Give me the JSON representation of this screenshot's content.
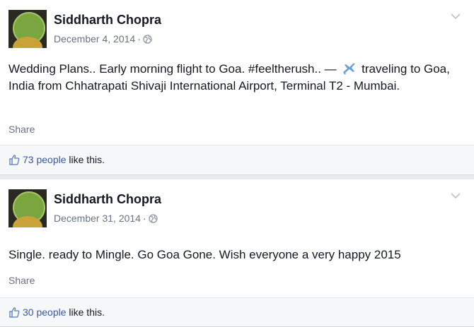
{
  "posts": [
    {
      "author": "Siddharth Chopra",
      "date": "December 4, 2014",
      "separator": "·",
      "text_before_icon": "Wedding Plans.. Early morning flight to Goa. #feeltherush.. —",
      "text_after_icon": "traveling to Goa, India from Chhatrapati Shivaji International Airport, Terminal T2 - Mumbai.",
      "share_label": "Share",
      "likes_count": "73 people",
      "likes_suffix": " like this."
    },
    {
      "author": "Siddharth Chopra",
      "date": "December 31, 2014",
      "separator": "·",
      "text": "Single. ready to Mingle. Go Goa Gone. Wish everyone a very happy 2015",
      "share_label": "Share",
      "likes_count": "30 people",
      "likes_suffix": " like this."
    }
  ],
  "colors": {
    "link": "#3b5998",
    "meta": "#6a7180",
    "background": "#e9eaed",
    "card": "#ffffff",
    "likes_bar": "#f6f7f8"
  },
  "icons": [
    "globe-icon",
    "chevron-down-icon",
    "airplane-icon",
    "thumbs-up-icon"
  ]
}
